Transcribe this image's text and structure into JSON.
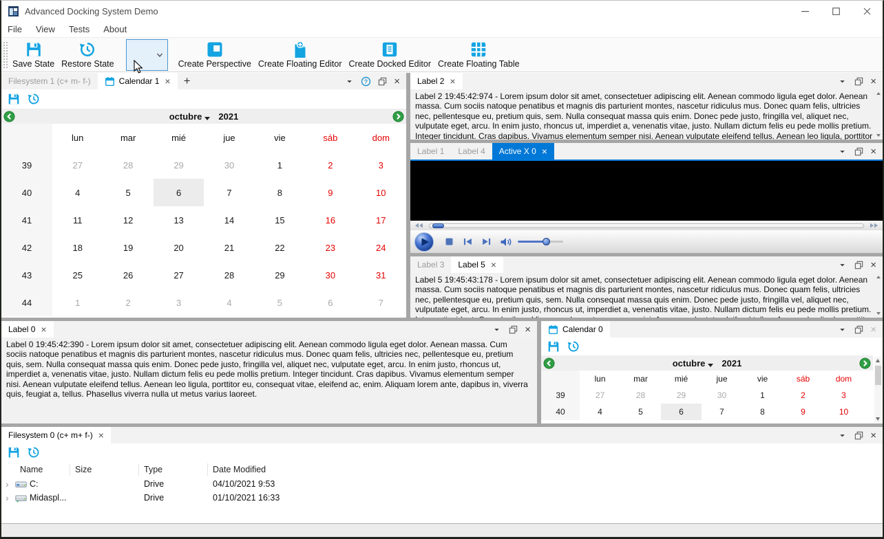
{
  "window": {
    "title": "Advanced Docking System Demo"
  },
  "menu": {
    "items": [
      "File",
      "View",
      "Tests",
      "About"
    ]
  },
  "toolbar": {
    "save_state": "Save State",
    "restore_state": "Restore State",
    "perspective_combo_value": "",
    "create_perspective": "Create Perspective",
    "create_floating_editor": "Create Floating Editor",
    "create_docked_editor": "Create Docked Editor",
    "create_floating_table": "Create Floating Table"
  },
  "panels": {
    "calendar1": {
      "tabs": [
        {
          "label": "Filesystem 1 (c+ m- f-)"
        },
        {
          "label": "Calendar 1"
        }
      ],
      "add_tab_label": "+",
      "month": "octubre",
      "year": "2021",
      "day_headers": [
        "lun",
        "mar",
        "mié",
        "jue",
        "vie",
        "sáb",
        "dom"
      ],
      "weeks": [
        {
          "num": "39",
          "days": [
            {
              "d": "27",
              "c": "out"
            },
            {
              "d": "28",
              "c": "out"
            },
            {
              "d": "29",
              "c": "out"
            },
            {
              "d": "30",
              "c": "out"
            },
            {
              "d": "1",
              "c": ""
            },
            {
              "d": "2",
              "c": "weekend"
            },
            {
              "d": "3",
              "c": "weekend"
            }
          ]
        },
        {
          "num": "40",
          "days": [
            {
              "d": "4",
              "c": ""
            },
            {
              "d": "5",
              "c": ""
            },
            {
              "d": "6",
              "c": "selected"
            },
            {
              "d": "7",
              "c": ""
            },
            {
              "d": "8",
              "c": ""
            },
            {
              "d": "9",
              "c": "weekend"
            },
            {
              "d": "10",
              "c": "weekend"
            }
          ]
        },
        {
          "num": "41",
          "days": [
            {
              "d": "11",
              "c": ""
            },
            {
              "d": "12",
              "c": ""
            },
            {
              "d": "13",
              "c": ""
            },
            {
              "d": "14",
              "c": ""
            },
            {
              "d": "15",
              "c": ""
            },
            {
              "d": "16",
              "c": "weekend"
            },
            {
              "d": "17",
              "c": "weekend"
            }
          ]
        },
        {
          "num": "42",
          "days": [
            {
              "d": "18",
              "c": ""
            },
            {
              "d": "19",
              "c": ""
            },
            {
              "d": "20",
              "c": ""
            },
            {
              "d": "21",
              "c": ""
            },
            {
              "d": "22",
              "c": ""
            },
            {
              "d": "23",
              "c": "weekend"
            },
            {
              "d": "24",
              "c": "weekend"
            }
          ]
        },
        {
          "num": "43",
          "days": [
            {
              "d": "25",
              "c": ""
            },
            {
              "d": "26",
              "c": ""
            },
            {
              "d": "27",
              "c": ""
            },
            {
              "d": "28",
              "c": ""
            },
            {
              "d": "29",
              "c": ""
            },
            {
              "d": "30",
              "c": "weekend"
            },
            {
              "d": "31",
              "c": "weekend"
            }
          ]
        },
        {
          "num": "44",
          "days": [
            {
              "d": "1",
              "c": "out"
            },
            {
              "d": "2",
              "c": "out"
            },
            {
              "d": "3",
              "c": "out"
            },
            {
              "d": "4",
              "c": "out"
            },
            {
              "d": "5",
              "c": "out"
            },
            {
              "d": "6",
              "c": "out"
            },
            {
              "d": "7",
              "c": "out"
            }
          ]
        }
      ]
    },
    "label2": {
      "tab": "Label 2",
      "text": "Label 2 19:45:42:974 - Lorem ipsum dolor sit amet, consectetuer adipiscing elit. Aenean commodo ligula eget dolor. Aenean massa. Cum sociis natoque penatibus et magnis dis parturient montes, nascetur ridiculus mus. Donec quam felis, ultricies nec, pellentesque eu, pretium quis, sem. Nulla consequat massa quis enim. Donec pede justo, fringilla vel, aliquet nec, vulputate eget, arcu. In enim justo, rhoncus ut, imperdiet a, venenatis vitae, justo. Nullam dictum felis eu pede mollis pretium. Integer tincidunt. Cras dapibus. Vivamus elementum semper nisi. Aenean vulputate eleifend tellus. Aenean leo ligula, porttitor eu, consequat vitae, eleifend ac, enim. Aliquam"
    },
    "activex": {
      "tabs": [
        "Label 1",
        "Label 4",
        "Active X 0"
      ],
      "active_tab": "Active X 0"
    },
    "label5": {
      "tabs": [
        "Label 3",
        "Label 5"
      ],
      "text": "Label 5 19:45:43:178 - Lorem ipsum dolor sit amet, consectetuer adipiscing elit. Aenean commodo ligula eget dolor. Aenean massa. Cum sociis natoque penatibus et magnis dis parturient montes, nascetur ridiculus mus. Donec quam felis, ultricies nec, pellentesque eu, pretium quis, sem. Nulla consequat massa quis enim. Donec pede justo, fringilla vel, aliquet nec, vulputate eget, arcu. In enim justo, rhoncus ut, imperdiet a, venenatis vitae, justo. Nullam dictum felis eu pede mollis pretium. Integer tincidunt. Cras dapibus. Vivamus elementum semper nisi. Aenean vulputate eleifend tellus. Aenean leo ligula, porttitor eu, consequat vitae, eleifend ac, enim. Aliquam"
    },
    "label0": {
      "tab": "Label 0",
      "text": "Label 0 19:45:42:390 - Lorem ipsum dolor sit amet, consectetuer adipiscing elit. Aenean commodo ligula eget dolor. Aenean massa. Cum sociis natoque penatibus et magnis dis parturient montes, nascetur ridiculus mus. Donec quam felis, ultricies nec, pellentesque eu, pretium quis, sem. Nulla consequat massa quis enim. Donec pede justo, fringilla vel, aliquet nec, vulputate eget, arcu. In enim justo, rhoncus ut, imperdiet a, venenatis vitae, justo. Nullam dictum felis eu pede mollis pretium. Integer tincidunt. Cras dapibus. Vivamus elementum semper nisi. Aenean vulputate eleifend tellus. Aenean leo ligula, porttitor eu, consequat vitae, eleifend ac, enim. Aliquam lorem ante, dapibus in, viverra quis, feugiat a, tellus. Phasellus viverra nulla ut metus varius laoreet."
    },
    "calendar0": {
      "tab": "Calendar 0",
      "month": "octubre",
      "year": "2021",
      "day_headers": [
        "lun",
        "mar",
        "mié",
        "jue",
        "vie",
        "sáb",
        "dom"
      ],
      "weeks": [
        {
          "num": "39",
          "days": [
            {
              "d": "27",
              "c": "out"
            },
            {
              "d": "28",
              "c": "out"
            },
            {
              "d": "29",
              "c": "out"
            },
            {
              "d": "30",
              "c": "out"
            },
            {
              "d": "1",
              "c": ""
            },
            {
              "d": "2",
              "c": "weekend"
            },
            {
              "d": "3",
              "c": "weekend"
            }
          ]
        },
        {
          "num": "40",
          "days": [
            {
              "d": "4",
              "c": ""
            },
            {
              "d": "5",
              "c": ""
            },
            {
              "d": "6",
              "c": "selected"
            },
            {
              "d": "7",
              "c": ""
            },
            {
              "d": "8",
              "c": ""
            },
            {
              "d": "9",
              "c": "weekend"
            },
            {
              "d": "10",
              "c": "weekend"
            }
          ]
        }
      ]
    },
    "filesystem0": {
      "tab": "Filesystem 0 (c+ m+ f-)",
      "columns": [
        "Name",
        "Size",
        "Type",
        "Date Modified"
      ],
      "rows": [
        {
          "name": "C:",
          "size": "",
          "type": "Drive",
          "date_modified": "04/10/2021 9:53",
          "icon": "drive-c"
        },
        {
          "name": "Midaspl...",
          "size": "",
          "type": "Drive",
          "date_modified": "01/10/2021 16:33",
          "icon": "drive-generic"
        }
      ]
    }
  },
  "colors": {
    "icon_cyan": "#14a4e2",
    "accent_blue": "#0078d7",
    "weekend_red": "#e60000",
    "nav_green": "#2f9e44"
  }
}
